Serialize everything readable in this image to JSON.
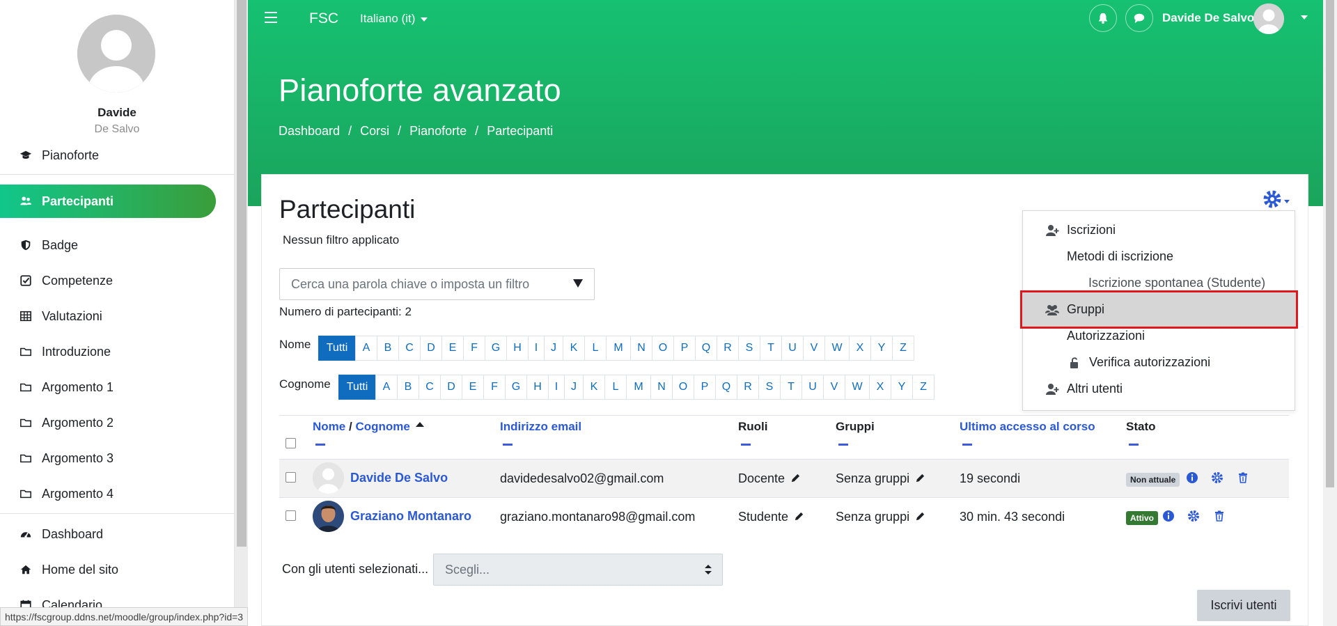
{
  "sidebar": {
    "user_first": "Davide",
    "user_last": "De Salvo",
    "items": [
      {
        "label": "Pianoforte",
        "icon": "graduation-cap-icon"
      },
      {
        "label": "Partecipanti",
        "icon": "users-icon"
      },
      {
        "label": "Badge",
        "icon": "shield-icon"
      },
      {
        "label": "Competenze",
        "icon": "check-square-icon"
      },
      {
        "label": "Valutazioni",
        "icon": "table-icon"
      },
      {
        "label": "Introduzione",
        "icon": "folder-icon"
      },
      {
        "label": "Argomento 1",
        "icon": "folder-icon"
      },
      {
        "label": "Argomento 2",
        "icon": "folder-icon"
      },
      {
        "label": "Argomento 3",
        "icon": "folder-icon"
      },
      {
        "label": "Argomento 4",
        "icon": "folder-icon"
      },
      {
        "label": "Dashboard",
        "icon": "tachometer-icon"
      },
      {
        "label": "Home del sito",
        "icon": "home-icon"
      },
      {
        "label": "Calendario",
        "icon": "calendar-icon"
      }
    ]
  },
  "topbar": {
    "brand": "FSC",
    "language": "Italiano (it)",
    "user_name": "Davide De Salvo"
  },
  "hero": {
    "course_title": "Pianoforte avanzato",
    "breadcrumb": [
      "Dashboard",
      "Corsi",
      "Pianoforte",
      "Partecipanti"
    ]
  },
  "main": {
    "title": "Partecipanti",
    "no_filter": "Nessun filtro applicato",
    "filter_placeholder": "Cerca una parola chiave o imposta un filtro",
    "count_text": "Numero di partecipanti: 2",
    "first_name_label": "Nome",
    "last_name_label": "Cognome",
    "all_label": "Tutti",
    "letters": [
      "A",
      "B",
      "C",
      "D",
      "E",
      "F",
      "G",
      "H",
      "I",
      "J",
      "K",
      "L",
      "M",
      "N",
      "O",
      "P",
      "Q",
      "R",
      "S",
      "T",
      "U",
      "V",
      "W",
      "X",
      "Y",
      "Z"
    ],
    "table": {
      "col_nome": "Nome",
      "col_sep": "/",
      "col_cognome": "Cognome",
      "col_email": "Indirizzo email",
      "col_ruoli": "Ruoli",
      "col_gruppi": "Gruppi",
      "col_ultimo": "Ultimo accesso al corso",
      "col_stato": "Stato",
      "rows": [
        {
          "name": "Davide De Salvo",
          "email": "davidedesalvo02@gmail.com",
          "role": "Docente",
          "groups": "Senza gruppi",
          "last_access": "19 secondi",
          "status": "Non attuale"
        },
        {
          "name": "Graziano Montanaro",
          "email": "graziano.montanaro98@gmail.com",
          "role": "Studente",
          "groups": "Senza gruppi",
          "last_access": "30 min. 43 secondi",
          "status": "Attivo"
        }
      ]
    },
    "with_selected_label": "Con gli utenti selezionati...",
    "with_selected_value": "Scegli...",
    "enrol_button": "Iscrivi utenti"
  },
  "settings_menu": {
    "items": [
      {
        "label": "Iscrizioni",
        "icon": "user-plus-icon"
      },
      {
        "label": "Metodi di iscrizione"
      },
      {
        "label": "Iscrizione spontanea (Studente)"
      },
      {
        "label": "Gruppi",
        "icon": "users-icon"
      },
      {
        "label": "Autorizzazioni"
      },
      {
        "label": "Verifica autorizzazioni",
        "icon": "unlock-icon"
      },
      {
        "label": "Altri utenti",
        "icon": "user-plus-icon"
      }
    ]
  },
  "status_bar": {
    "url": "https://fscgroup.ddns.net/moodle/group/index.php?id=3"
  },
  "colors": {
    "accent_green": "#16c171",
    "link_blue": "#2b59d6",
    "active_letter": "#0f6cbf",
    "highlight_red": "#e0181b"
  }
}
